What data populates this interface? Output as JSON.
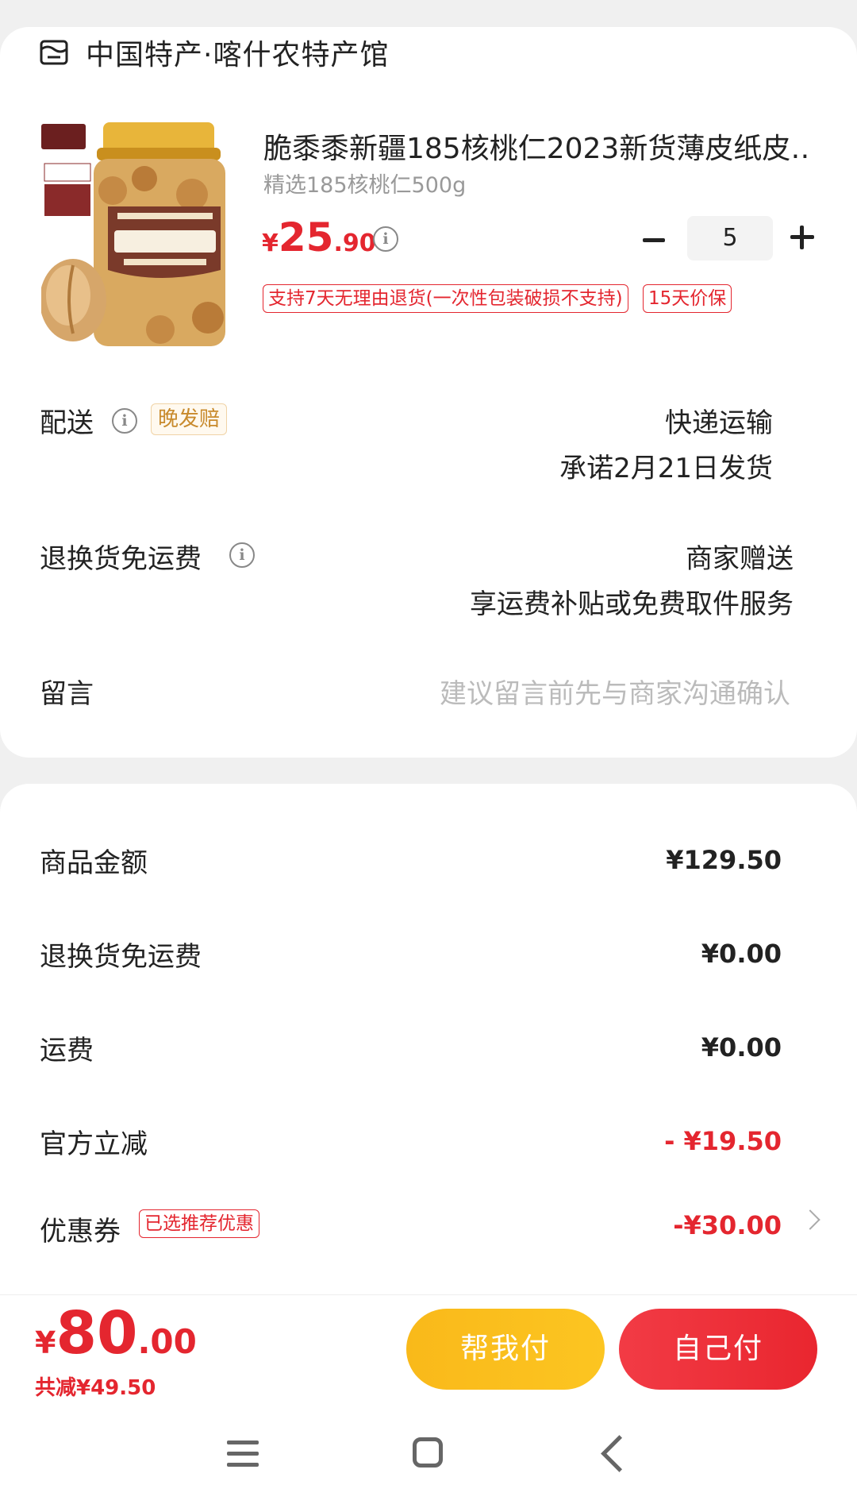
{
  "shop": {
    "name": "中国特产·喀什农特产馆",
    "icon": "shop-icon"
  },
  "product": {
    "title": "脆黍黍新疆185核桃仁2023新货薄皮纸皮…",
    "spec": "精选185核桃仁500g",
    "price_currency": "¥",
    "price_int": "25",
    "price_dec": ".90",
    "quantity": "5",
    "tags": [
      "支持7天无理由退货(一次性包装破损不支持)",
      "15天价保"
    ]
  },
  "delivery": {
    "label": "配送",
    "badge": "晚发赔",
    "method": "快递运输",
    "promise": "承诺2月21日发货"
  },
  "return_shipping": {
    "label": "退换货免运费",
    "line1": "商家赠送",
    "line2": "享运费补贴或免费取件服务"
  },
  "message": {
    "label": "留言",
    "placeholder": "建议留言前先与商家沟通确认"
  },
  "fees": {
    "goods_label": "商品金额",
    "goods_value": "¥129.50",
    "return_label": "退换货免运费",
    "return_value": "¥0.00",
    "shipping_label": "运费",
    "shipping_value": "¥0.00",
    "discount_label": "官方立减",
    "discount_value": "- ¥19.50",
    "coupon_label": "优惠券",
    "coupon_tag": "已选推荐优惠",
    "coupon_value": "-¥30.00"
  },
  "footer": {
    "total_currency": "¥",
    "total_int": "80",
    "total_dec": ".00",
    "saved": "共减¥49.50",
    "help_pay": "帮我付",
    "self_pay": "自己付"
  },
  "colors": {
    "accent": "#e4262f",
    "help_button": "#fbbf1e",
    "badge_gold": "#c88a2c"
  }
}
